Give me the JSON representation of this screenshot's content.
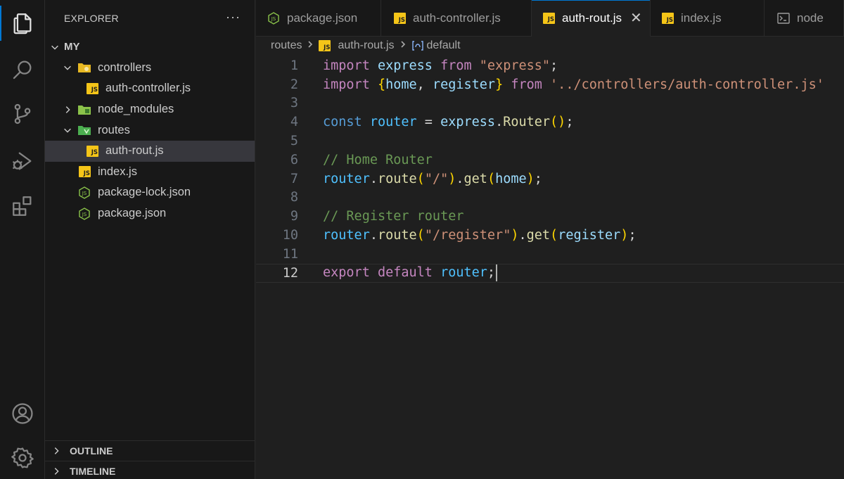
{
  "activity_bar": {
    "items": [
      "files-icon",
      "search-icon",
      "source-control-icon",
      "run-debug-icon",
      "extensions-icon"
    ],
    "bottom": [
      "account-icon",
      "gear-icon"
    ]
  },
  "explorer": {
    "title": "EXPLORER",
    "more": "···",
    "root": "MY",
    "tree": [
      {
        "label": "controllers",
        "type": "folder",
        "depth": 1,
        "expanded": true
      },
      {
        "label": "auth-controller.js",
        "type": "js",
        "depth": 2
      },
      {
        "label": "node_modules",
        "type": "folder",
        "depth": 1,
        "expanded": false
      },
      {
        "label": "routes",
        "type": "folder",
        "depth": 1,
        "expanded": true
      },
      {
        "label": "auth-rout.js",
        "type": "js",
        "depth": 2,
        "selected": true
      },
      {
        "label": "index.js",
        "type": "js",
        "depth": 1
      },
      {
        "label": "package-lock.json",
        "type": "json",
        "depth": 1
      },
      {
        "label": "package.json",
        "type": "json",
        "depth": 1
      }
    ],
    "outline": "OUTLINE",
    "timeline": "TIMELINE"
  },
  "tabs": [
    {
      "label": "package.json",
      "icon": "json"
    },
    {
      "label": "auth-controller.js",
      "icon": "js"
    },
    {
      "label": "auth-rout.js",
      "icon": "js",
      "active": true,
      "close": "✕"
    },
    {
      "label": "index.js",
      "icon": "js"
    },
    {
      "label": "node",
      "icon": "terminal"
    }
  ],
  "breadcrumb": {
    "folder": "routes",
    "file": "auth-rout.js",
    "symbol": "default"
  },
  "js_badge": "JS",
  "editor": {
    "current_line": 12,
    "lines": [
      {
        "n": "1"
      },
      {
        "n": "2"
      },
      {
        "n": "3"
      },
      {
        "n": "4"
      },
      {
        "n": "5"
      },
      {
        "n": "6"
      },
      {
        "n": "7"
      },
      {
        "n": "8"
      },
      {
        "n": "9"
      },
      {
        "n": "10"
      },
      {
        "n": "11"
      },
      {
        "n": "12"
      }
    ],
    "tokens": {
      "l1": [
        "import",
        " ",
        "express",
        " ",
        "from",
        " ",
        "\"express\"",
        ";"
      ],
      "l2": [
        "import",
        " ",
        "{",
        "home",
        ", ",
        "register",
        "}",
        " ",
        "from",
        " ",
        "'../controllers/auth-controller.js'"
      ],
      "l4": [
        "const",
        " ",
        "router",
        " = ",
        "express",
        ".",
        "Router",
        "(",
        ")",
        ";"
      ],
      "l6": [
        "// Home Router"
      ],
      "l7": [
        "router",
        ".",
        "route",
        "(",
        "\"/\"",
        ")",
        ".",
        "get",
        "(",
        "home",
        ")",
        ";"
      ],
      "l9": [
        "// Register router"
      ],
      "l10": [
        "router",
        ".",
        "route",
        "(",
        "\"/register\"",
        ")",
        ".",
        "get",
        "(",
        "register",
        ")",
        ";"
      ],
      "l12": [
        "export",
        " ",
        "default",
        " ",
        "router",
        ";"
      ]
    }
  }
}
